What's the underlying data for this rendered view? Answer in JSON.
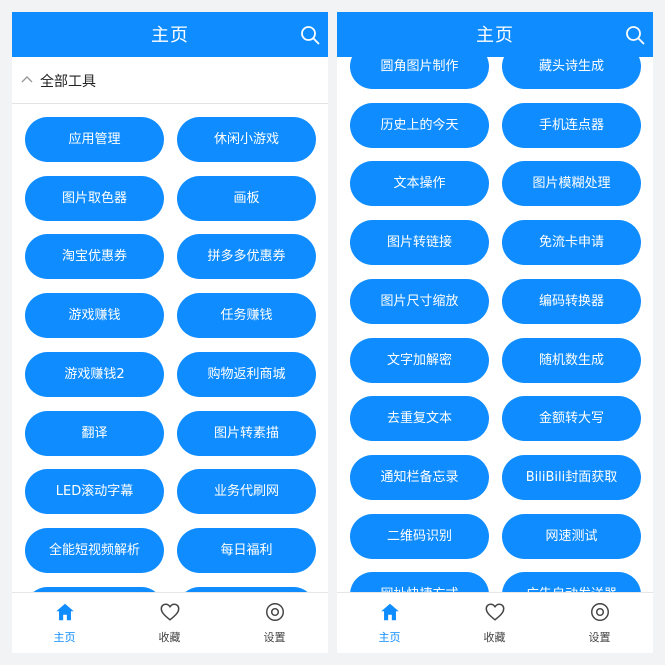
{
  "colors": {
    "accent": "#0f8cff",
    "background": "#f2f3f5",
    "button_text": "#ffffff"
  },
  "left_screen": {
    "header": {
      "title": "主页",
      "search_icon": "search-icon"
    },
    "section": {
      "title": "全部工具",
      "toggle_icon": "chevron-up-icon"
    },
    "tools": [
      "应用管理",
      "休闲小游戏",
      "图片取色器",
      "画板",
      "淘宝优惠券",
      "拼多多优惠券",
      "游戏赚钱",
      "任务赚钱",
      "游戏赚钱2",
      "购物返利商城",
      "翻译",
      "图片转素描",
      "LED滚动字幕",
      "业务代刷网",
      "全能短视频解析",
      "每日福利",
      "",
      ""
    ]
  },
  "right_screen": {
    "header": {
      "title": "主页",
      "search_icon": "search-icon"
    },
    "tools": [
      "圆角图片制作",
      "藏头诗生成",
      "历史上的今天",
      "手机连点器",
      "文本操作",
      "图片模糊处理",
      "图片转链接",
      "免流卡申请",
      "图片尺寸缩放",
      "编码转换器",
      "文字加解密",
      "随机数生成",
      "去重复文本",
      "金额转大写",
      "通知栏备忘录",
      "BiliBili封面获取",
      "二维码识别",
      "网速测试",
      "网址快捷方式",
      "广告自动发送器"
    ]
  },
  "bottom_nav": [
    {
      "label": "主页",
      "icon": "home-icon",
      "active": true
    },
    {
      "label": "收藏",
      "icon": "heart-icon",
      "active": false
    },
    {
      "label": "设置",
      "icon": "settings-icon",
      "active": false
    }
  ]
}
